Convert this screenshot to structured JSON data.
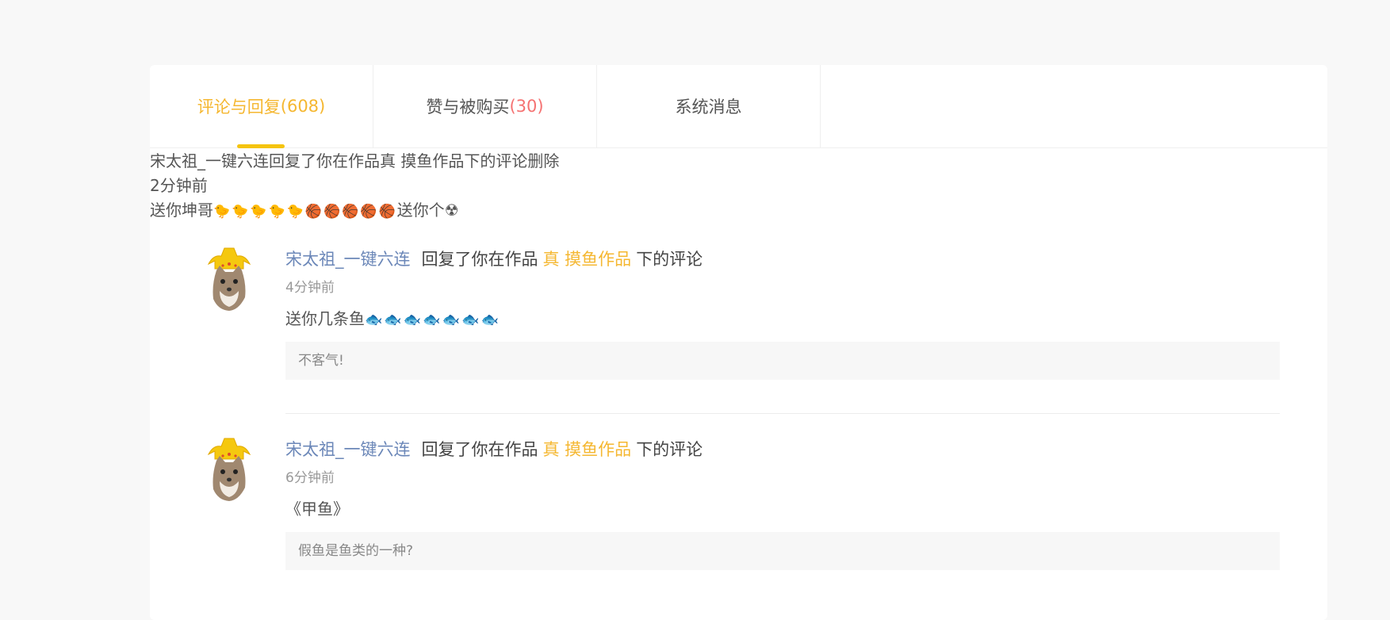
{
  "tabs": [
    {
      "label": "评论与回复",
      "count": "(608)"
    },
    {
      "label": "赞与被购买",
      "count": "(30)"
    },
    {
      "label": "系统消息",
      "count": ""
    }
  ],
  "notice": {
    "line1": "宋太祖_一键六连回复了你在作品真 摸鱼作品下的评论删除",
    "line2": "2分钟前",
    "line3_text": "送你坤哥",
    "line3_emoji": "🐤🐤🐤🐤🐤🏀🏀🏀🏀🏀",
    "line3_tail": "送你个☢"
  },
  "comments": [
    {
      "user": "宋太祖_一键六连",
      "action": "回复了你在作品",
      "work": "真 摸鱼作品",
      "suffix": "下的评论",
      "time": "4分钟前",
      "text": "送你几条鱼",
      "emoji": "🐟🐟🐟🐟🐟🐟🐟",
      "reply": "不客气!"
    },
    {
      "user": "宋太祖_一键六连",
      "action": "回复了你在作品",
      "work": "真 摸鱼作品",
      "suffix": "下的评论",
      "time": "6分钟前",
      "text": "《甲鱼》",
      "emoji": "",
      "reply": "假鱼是鱼类的一种?"
    }
  ],
  "colors": {
    "accent": "#f5b730",
    "count_red": "#f57272",
    "user_blue": "#6b87b8",
    "underline": "#f5c40f"
  },
  "icons": {
    "avatar": "crowned-cat-avatar-icon"
  }
}
